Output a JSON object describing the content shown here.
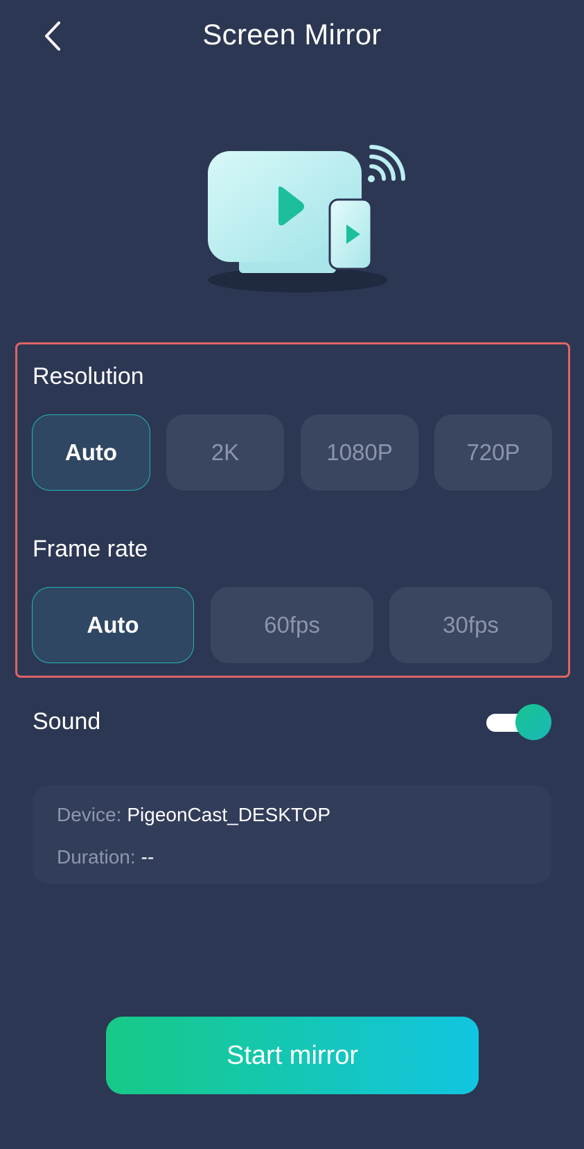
{
  "header": {
    "title": "Screen Mirror",
    "back_icon": "chevron-left-icon"
  },
  "hero": {
    "icon": "tv-phone-cast-icon",
    "colors": {
      "screen": "#c9f3f4",
      "play": "#1cbf9a"
    }
  },
  "resolution": {
    "label": "Resolution",
    "options": [
      "Auto",
      "2K",
      "1080P",
      "720P"
    ],
    "selected": "Auto"
  },
  "frame_rate": {
    "label": "Frame rate",
    "options": [
      "Auto",
      "60fps",
      "30fps"
    ],
    "selected": "Auto"
  },
  "sound": {
    "label": "Sound",
    "enabled": true
  },
  "info": {
    "device_key": "Device:",
    "device_value": "PigeonCast_DESKTOP",
    "duration_key": "Duration:",
    "duration_value": "--"
  },
  "start_button": {
    "label": "Start mirror"
  },
  "colors": {
    "background": "#2c3753",
    "accent": "#17c48f",
    "highlight_border": "#e06465"
  }
}
